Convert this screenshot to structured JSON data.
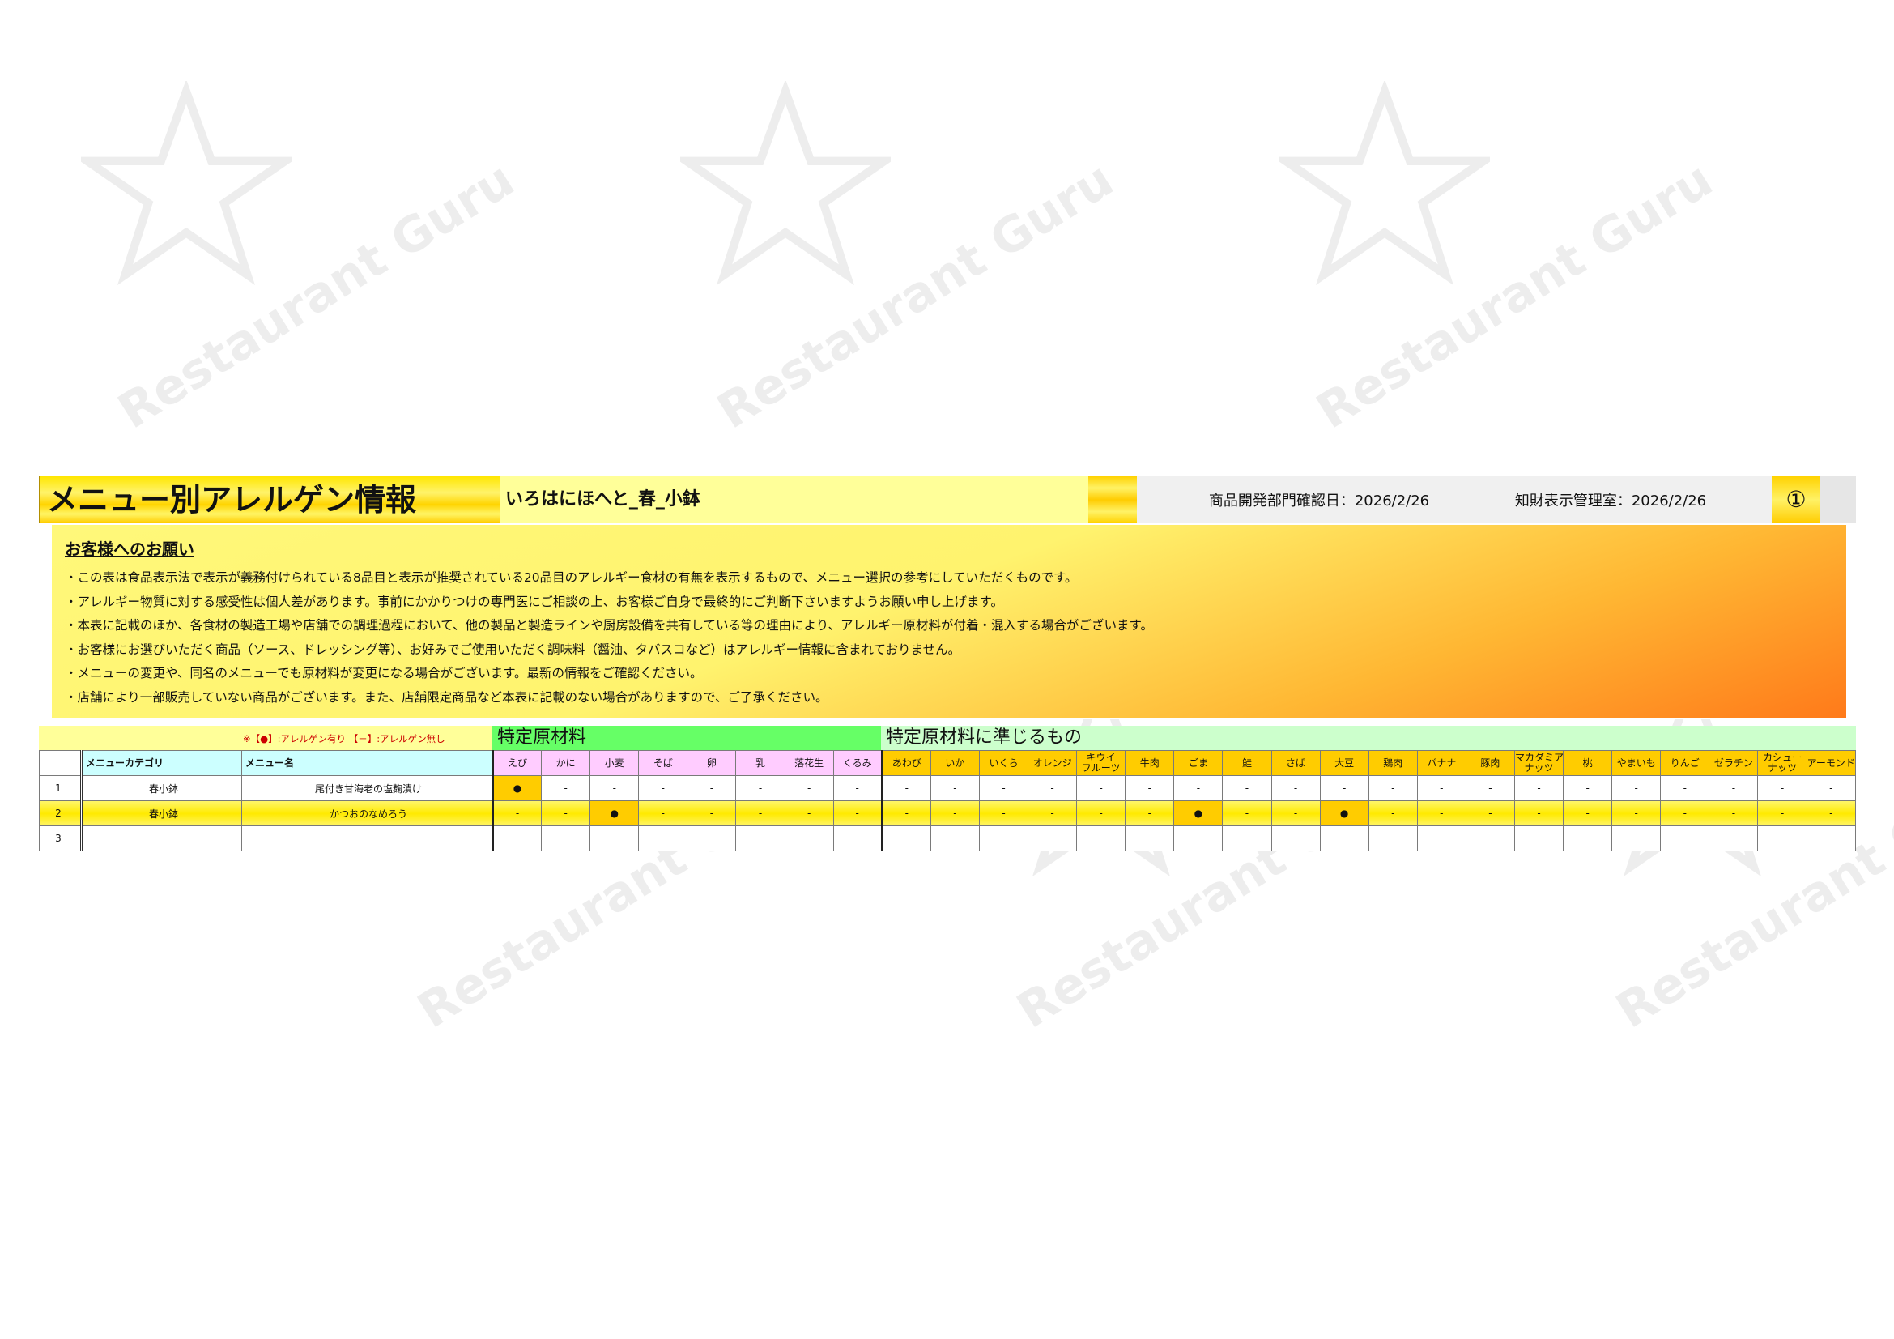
{
  "watermark": "Restaurant Guru",
  "header": {
    "title": "メニュー別アレルゲン情報",
    "subtitle": "いろはにほへと_春_小鉢",
    "dept_confirm": "商品開発部門確認日：2026/2/26",
    "label_confirm": "知財表示管理室：2026/2/26",
    "page_mark": "①"
  },
  "notice": {
    "title": "お客様へのお願い",
    "lines": [
      "・この表は食品表示法で表示が義務付けられている8品目と表示が推奨されている20品目のアレルギー食材の有無を表示するもので、メニュー選択の参考にしていただくものです。",
      "・アレルギー物質に対する感受性は個人差があります。事前にかかりつけの専門医にご相談の上、お客様ご自身で最終的にご判断下さいますようお願い申し上げます。",
      "・本表に記載のほか、各食材の製造工場や店舗での調理過程において、他の製品と製造ラインや厨房設備を共有している等の理由により、アレルギー原材料が付着・混入する場合がございます。",
      "・お客様にお選びいただく商品（ソース、ドレッシング等）、お好みでご使用いただく調味料（醤油、タバスコなど）はアレルギー情報に含まれておりません。",
      "・メニューの変更や、同名のメニューでも原材料が変更になる場合がございます。最新の情報をご確認ください。",
      "・店舗により一部販売していない商品がございます。また、店舗限定商品など本表に記載のない場合がありますので、ご了承ください。"
    ]
  },
  "legend": "※【●】:アレルゲン有り 【－】:アレルゲン無し",
  "group_mandatory": "特定原材料",
  "group_recommended": "特定原材料に準じるもの",
  "columns": {
    "category": "メニューカテゴリ",
    "name": "メニュー名",
    "mandatory": [
      "えび",
      "かに",
      "小麦",
      "そば",
      "卵",
      "乳",
      "落花生",
      "くるみ"
    ],
    "recommended": [
      "あわび",
      "いか",
      "いくら",
      "オレンジ",
      "キウイ\nフルーツ",
      "牛肉",
      "ごま",
      "鮭",
      "さば",
      "大豆",
      "鶏肉",
      "バナナ",
      "豚肉",
      "マカダミア\nナッツ",
      "桃",
      "やまいも",
      "りんご",
      "ゼラチン",
      "カシュー\nナッツ",
      "アーモンド"
    ]
  },
  "rows": [
    {
      "no": "1",
      "category": "春小鉢",
      "name": "尾付き甘海老の塩麹漬け",
      "marks": [
        "●",
        "-",
        "-",
        "-",
        "-",
        "-",
        "-",
        "-",
        "-",
        "-",
        "-",
        "-",
        "-",
        "-",
        "-",
        "-",
        "-",
        "-",
        "-",
        "-",
        "-",
        "-",
        "-",
        "-",
        "-",
        "-",
        "-",
        "-"
      ]
    },
    {
      "no": "2",
      "category": "春小鉢",
      "name": "かつおのなめろう",
      "marks": [
        "-",
        "-",
        "●",
        "-",
        "-",
        "-",
        "-",
        "-",
        "-",
        "-",
        "-",
        "-",
        "-",
        "-",
        "●",
        "-",
        "-",
        "●",
        "-",
        "-",
        "-",
        "-",
        "-",
        "-",
        "-",
        "-",
        "-",
        "-"
      ]
    },
    {
      "no": "3",
      "category": "",
      "name": "",
      "marks": [
        "",
        "",
        "",
        "",
        "",
        "",
        "",
        "",
        "",
        "",
        "",
        "",
        "",
        "",
        "",
        "",
        "",
        "",
        "",
        "",
        "",
        "",
        "",
        "",
        "",
        "",
        "",
        ""
      ]
    }
  ]
}
